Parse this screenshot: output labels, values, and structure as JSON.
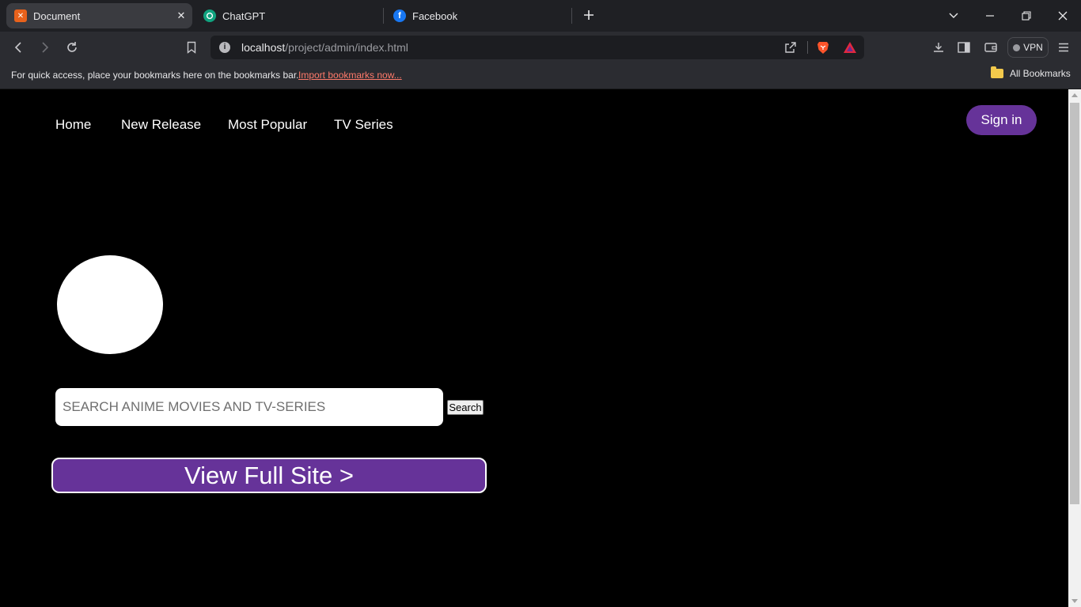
{
  "browser": {
    "tabs": [
      {
        "title": "Document",
        "favicon": "xampp-icon",
        "active": true
      },
      {
        "title": "ChatGPT",
        "favicon": "chatgpt-icon",
        "active": false
      },
      {
        "title": "Facebook",
        "favicon": "facebook-icon",
        "active": false
      }
    ],
    "address": {
      "host": "localhost",
      "path": "/project/admin/index.html"
    },
    "vpn_label": "VPN",
    "bookmarks_bar": {
      "prompt": "For quick access, place your bookmarks here on the bookmarks bar.",
      "import_link": "Import bookmarks now...",
      "all_bookmarks": "All Bookmarks"
    },
    "colors": {
      "tabbar_bg": "#1f2024",
      "toolbar_bg": "#2b2c31",
      "link_accent": "#ff7a6a"
    }
  },
  "page": {
    "nav": {
      "links": [
        "Home",
        "New Release",
        "Most Popular",
        "TV Series"
      ],
      "signin_label": "Sign in"
    },
    "search": {
      "placeholder": "SEARCH ANIME MOVIES AND TV-SERIES",
      "value": "",
      "button_label": "Search"
    },
    "full_site_label": "View Full Site >",
    "colors": {
      "background": "#000000",
      "accent_purple": "#663399",
      "text": "#ffffff"
    }
  }
}
